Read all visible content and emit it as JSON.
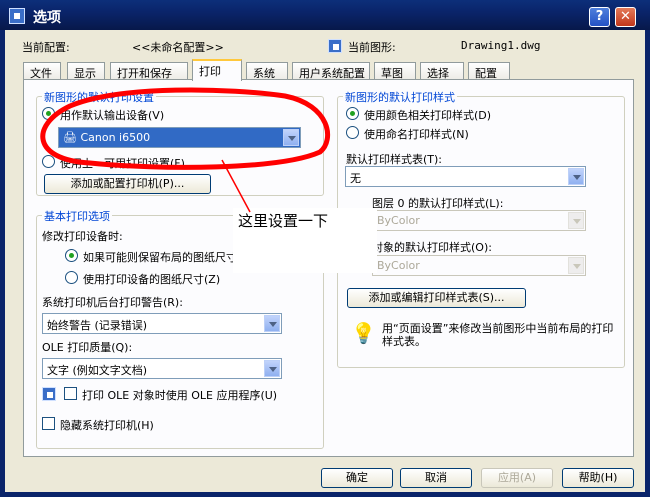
{
  "window": {
    "title": "选项",
    "help_btn": "?",
    "close_btn": "✕"
  },
  "header": {
    "current_profile_label": "当前配置:",
    "current_profile_value": "<<未命名配置>>",
    "current_drawing_label": "当前图形:",
    "current_drawing_value": "Drawing1.dwg"
  },
  "tabs": [
    "文件",
    "显示",
    "打开和保存",
    "打印",
    "系统",
    "用户系统配置",
    "草图",
    "选择",
    "配置"
  ],
  "active_tab": "打印",
  "left": {
    "default_output_group": "新图形的默认打印设置",
    "use_default_device": "用作默认输出设备(V)",
    "device_value": "Canon i6500",
    "use_last_settings": "使用上一可用打印设置(F)",
    "add_printer_btn": "添加或配置打印机(P)...",
    "basic_group": "基本打印选项",
    "modify_device_label": "修改打印设备时:",
    "keep_layout": "如果可能则保留布局的图纸尺寸(K)",
    "use_device_size": "使用打印设备的图纸尺寸(Z)",
    "spool_alert_label": "系统打印机后台打印警告(R):",
    "spool_alert_value": "始终警告 (记录错误)",
    "ole_quality_label": "OLE 打印质量(Q):",
    "ole_quality_value": "文字 (例如文字文档)",
    "ole_app_check": "打印 OLE 对象时使用 OLE 应用程序(U)",
    "hide_sys_printers": "隐藏系统打印机(H)"
  },
  "right": {
    "style_group": "新图形的默认打印样式",
    "use_color_styles": "使用颜色相关打印样式(D)",
    "use_named_styles": "使用命名打印样式(N)",
    "default_style_table_label": "默认打印样式表(T):",
    "default_style_table_value": "无",
    "layer0_label": "图层 0 的默认打印样式(L):",
    "layer0_value": "ByColor",
    "object_label": "对象的默认打印样式(O):",
    "object_value": "ByColor",
    "add_edit_styles_btn": "添加或编辑打印样式表(S)...",
    "info_text": "用“页面设置”来修改当前图形中当前布局的打印样式表。"
  },
  "annotation": {
    "hint": "这里设置一下",
    "color": "#ff0000"
  },
  "footer": {
    "ok": "确定",
    "cancel": "取消",
    "apply": "应用(A)",
    "help": "帮助(H)"
  }
}
